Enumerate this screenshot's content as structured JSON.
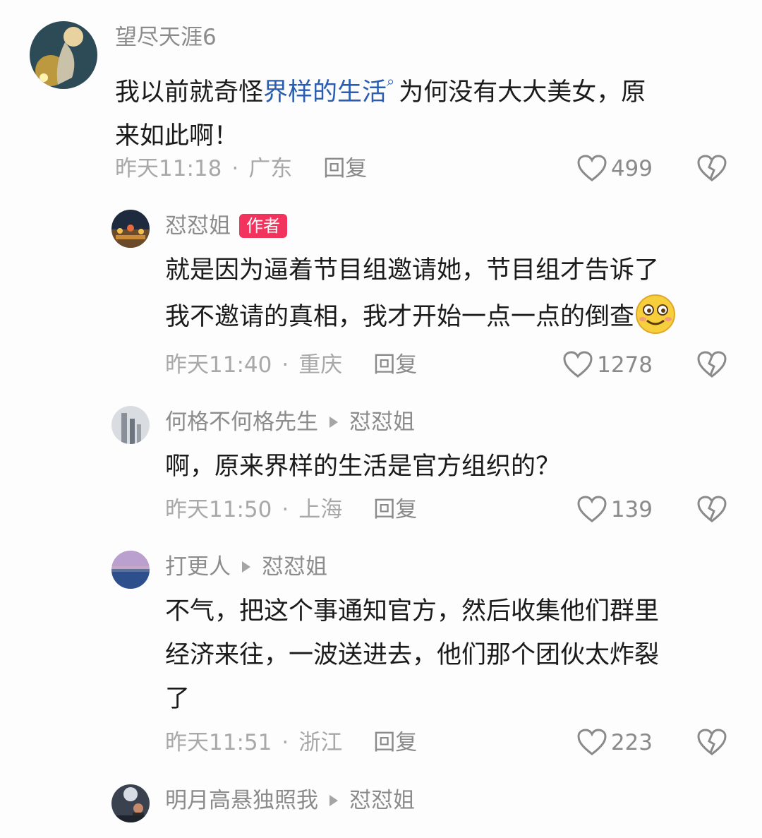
{
  "comments": [
    {
      "username": "望尽天涯6",
      "text_pre": "我以前就奇怪",
      "link": "界样的生活",
      "link_icon": "search-icon",
      "text_post_line1": "为何没有大大美女，原",
      "text_line2": "来如此啊！",
      "time": "昨天11:18",
      "location": "广东",
      "reply_label": "回复",
      "likes": "499"
    },
    {
      "username": "怼怼姐",
      "badge": "作者",
      "line1": "就是因为逼着节目组邀请她，节目组才告诉了",
      "line2": "我不邀请的真相，我才开始一点一点的倒查",
      "emoji": "smiling-face-emoji",
      "time": "昨天11:40",
      "location": "重庆",
      "reply_label": "回复",
      "likes": "1278"
    },
    {
      "username": "何格不何格先生",
      "reply_to": "怼怼姐",
      "line1": "啊，原来界样的生活是官方组织的？",
      "time": "昨天11:50",
      "location": "上海",
      "reply_label": "回复",
      "likes": "139"
    },
    {
      "username": "打更人",
      "reply_to": "怼怼姐",
      "line1": "不气，把这个事通知官方，然后收集他们群里",
      "line2": "经济来往，一波送进去，他们那个团伙太炸裂",
      "line3": "了",
      "time": "昨天11:51",
      "location": "浙江",
      "reply_label": "回复",
      "likes": "223"
    },
    {
      "username": "明月高悬独照我",
      "reply_to": "怼怼姐"
    }
  ],
  "separator": "·",
  "colors": {
    "accent_badge": "#f2335e",
    "link": "#2a5db0",
    "muted": "#a8a8a8"
  }
}
